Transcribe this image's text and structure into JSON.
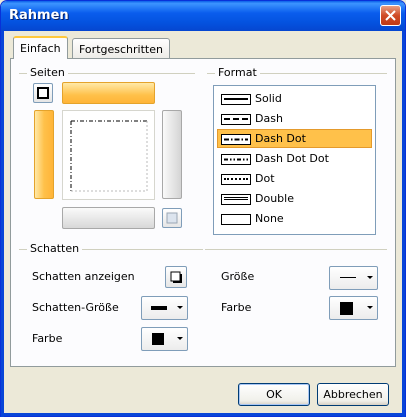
{
  "window": {
    "title": "Rahmen"
  },
  "tabs": [
    {
      "label": "Einfach",
      "active": true
    },
    {
      "label": "Fortgeschritten",
      "active": false
    }
  ],
  "groups": {
    "sides": "Seiten",
    "format": "Format",
    "shadow": "Schatten"
  },
  "format_list": [
    {
      "label": "Solid",
      "style": "solid",
      "selected": false
    },
    {
      "label": "Dash",
      "style": "dash",
      "selected": false
    },
    {
      "label": "Dash Dot",
      "style": "dashdot",
      "selected": true
    },
    {
      "label": "Dash Dot Dot",
      "style": "dashdotdot",
      "selected": false
    },
    {
      "label": "Dot",
      "style": "dot",
      "selected": false
    },
    {
      "label": "Double",
      "style": "double",
      "selected": false
    },
    {
      "label": "None",
      "style": "none",
      "selected": false
    }
  ],
  "shadow": {
    "show_label": "Schatten anzeigen",
    "size_label": "Schatten-Größe",
    "color_label": "Farbe",
    "size_right_label": "Größe",
    "color_right_label": "Farbe"
  },
  "buttons": {
    "ok": "OK",
    "cancel": "Abbrechen"
  },
  "colors": {
    "selection": "#ffc14a",
    "titlebar": "#0a5ded",
    "swatch_color": "#000000"
  }
}
